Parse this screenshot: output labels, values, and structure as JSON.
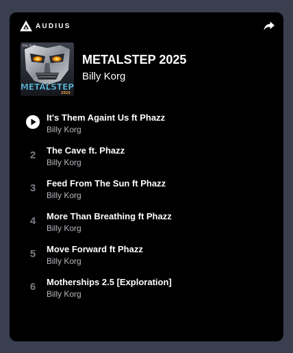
{
  "brand": {
    "name": "AUDIUS",
    "logo_icon": "audius-triangle-logo"
  },
  "header": {
    "share_icon": "share-arrow-icon"
  },
  "album": {
    "title": "METALSTEP 2025",
    "artist": "Billy Korg",
    "artwork": {
      "text": "METALSTEP",
      "subtext": "2025",
      "badge": "Billy Korg"
    }
  },
  "tracks": [
    {
      "index": "",
      "state": "playable",
      "icon": "play-circle-icon",
      "title": "It's Them Againt Us ft Phazz",
      "artist": "Billy Korg"
    },
    {
      "index": "2",
      "title": "The Cave ft. Phazz",
      "artist": "Billy Korg"
    },
    {
      "index": "3",
      "title": "Feed From The Sun ft Phazz",
      "artist": "Billy Korg"
    },
    {
      "index": "4",
      "title": "More Than Breathing ft Phazz",
      "artist": "Billy Korg"
    },
    {
      "index": "5",
      "title": "Move Forward ft Phazz",
      "artist": "Billy Korg"
    },
    {
      "index": "6",
      "title": "Motherships 2.5 [Exploration]",
      "artist": "Billy Korg"
    }
  ],
  "colors": {
    "page_background": "#3a3f50",
    "card_background": "#000000",
    "text_primary": "#ffffff",
    "text_secondary": "#b8b8c0",
    "track_number": "#7c7c85",
    "artwork_accent": "#6fc7e6"
  }
}
